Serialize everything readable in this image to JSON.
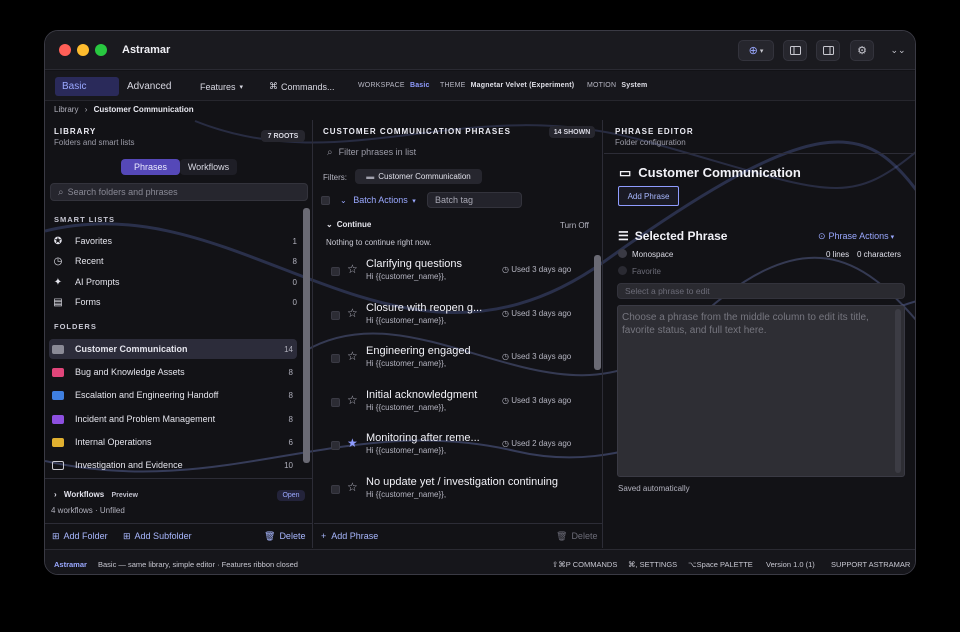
{
  "app": {
    "title": "Astramar"
  },
  "ribbon": {
    "tabs": [
      "Basic",
      "Advanced"
    ],
    "features_label": "Features",
    "commands_label": "Commands...",
    "workspace_label": "WORKSPACE",
    "workspace_value": "Basic",
    "theme_label": "THEME",
    "theme_value": "Magnetar Velvet (Experiment)",
    "motion_label": "MOTION",
    "motion_value": "System"
  },
  "breadcrumb": {
    "root": "Library",
    "sep": "›",
    "current": "Customer Communication"
  },
  "library": {
    "title": "LIBRARY",
    "subtitle": "Folders and smart lists",
    "roots_badge": "7 ROOTS",
    "seg_phrases": "Phrases",
    "seg_workflows": "Workflows",
    "search_placeholder": "Search folders and phrases",
    "smart_title": "SMART LISTS",
    "smart_lists": [
      {
        "label": "Favorites",
        "count": "1",
        "icon": "star-circle-icon"
      },
      {
        "label": "Recent",
        "count": "8",
        "icon": "clock-icon"
      },
      {
        "label": "AI Prompts",
        "count": "0",
        "icon": "sparkle-icon"
      },
      {
        "label": "Forms",
        "count": "0",
        "icon": "form-icon"
      }
    ],
    "folders_title": "FOLDERS",
    "folders": [
      {
        "label": "Customer Communication",
        "count": "14",
        "color": "#8a8a96"
      },
      {
        "label": "Bug and Knowledge Assets",
        "count": "8",
        "color": "#e0457a"
      },
      {
        "label": "Escalation and Engineering Handoff",
        "count": "8",
        "color": "#3f7fe0"
      },
      {
        "label": "Incident and Problem Management",
        "count": "8",
        "color": "#8d4fe0"
      },
      {
        "label": "Internal Operations",
        "count": "6",
        "color": "#e0b030"
      },
      {
        "label": "Investigation and Evidence",
        "count": "10",
        "color": "#c8c8d0"
      }
    ],
    "workflows_label": "Workflows",
    "workflows_badge": "Preview",
    "workflows_open": "Open",
    "workflows_sub": "4 workflows · Unfiled",
    "add_folder": "Add Folder",
    "add_subfolder": "Add Subfolder",
    "delete": "Delete"
  },
  "phrases": {
    "title": "CUSTOMER COMMUNICATION PHRASES",
    "shown_badge": "14 SHOWN",
    "filter_placeholder": "Filter phrases in list",
    "filters_label": "Filters:",
    "filter_chip": "Customer Communication",
    "batch_actions": "Batch Actions",
    "batch_tag_placeholder": "Batch tag",
    "continue_label": "Continue",
    "turn_off": "Turn Off",
    "continue_empty": "Nothing to continue right now.",
    "items": [
      {
        "title": "Clarifying questions",
        "snippet": "Hi {{customer_name}},",
        "used": "Used 3 days ago",
        "fav": false
      },
      {
        "title": "Closure with reopen g...",
        "snippet": "Hi {{customer_name}},",
        "used": "Used 3 days ago",
        "fav": false
      },
      {
        "title": "Engineering engaged",
        "snippet": "Hi {{customer_name}},",
        "used": "Used 3 days ago",
        "fav": false
      },
      {
        "title": "Initial acknowledgment",
        "snippet": "Hi {{customer_name}},",
        "used": "Used 3 days ago",
        "fav": false
      },
      {
        "title": "Monitoring after reme...",
        "snippet": "Hi {{customer_name}},",
        "used": "Used 2 days ago",
        "fav": true
      },
      {
        "title": "No update yet / investigation continuing",
        "snippet": "Hi {{customer_name}},",
        "used": "",
        "fav": false
      }
    ],
    "add_phrase": "Add Phrase",
    "delete": "Delete"
  },
  "editor": {
    "title": "PHRASE EDITOR",
    "subtitle": "Folder configuration",
    "folder_name": "Customer Communication",
    "add_phrase": "Add Phrase",
    "selected_title": "Selected Phrase",
    "phrase_actions": "Phrase Actions",
    "monospace": "Monospace",
    "favorite": "Favorite",
    "lines": "0 lines",
    "characters": "0 characters",
    "title_placeholder": "Select a phrase to edit",
    "body_placeholder": "Choose a phrase from the middle column to edit its title, favorite status, and full text here.",
    "saved": "Saved automatically"
  },
  "footer": {
    "brand": "Astramar",
    "status": "Basic — same library, simple editor · Features ribbon closed",
    "commands": "⇧⌘P COMMANDS",
    "settings": "⌘, SETTINGS",
    "palette": "⌥Space PALETTE",
    "version": "Version 1.0 (1)",
    "support": "SUPPORT ASTRAMAR"
  }
}
